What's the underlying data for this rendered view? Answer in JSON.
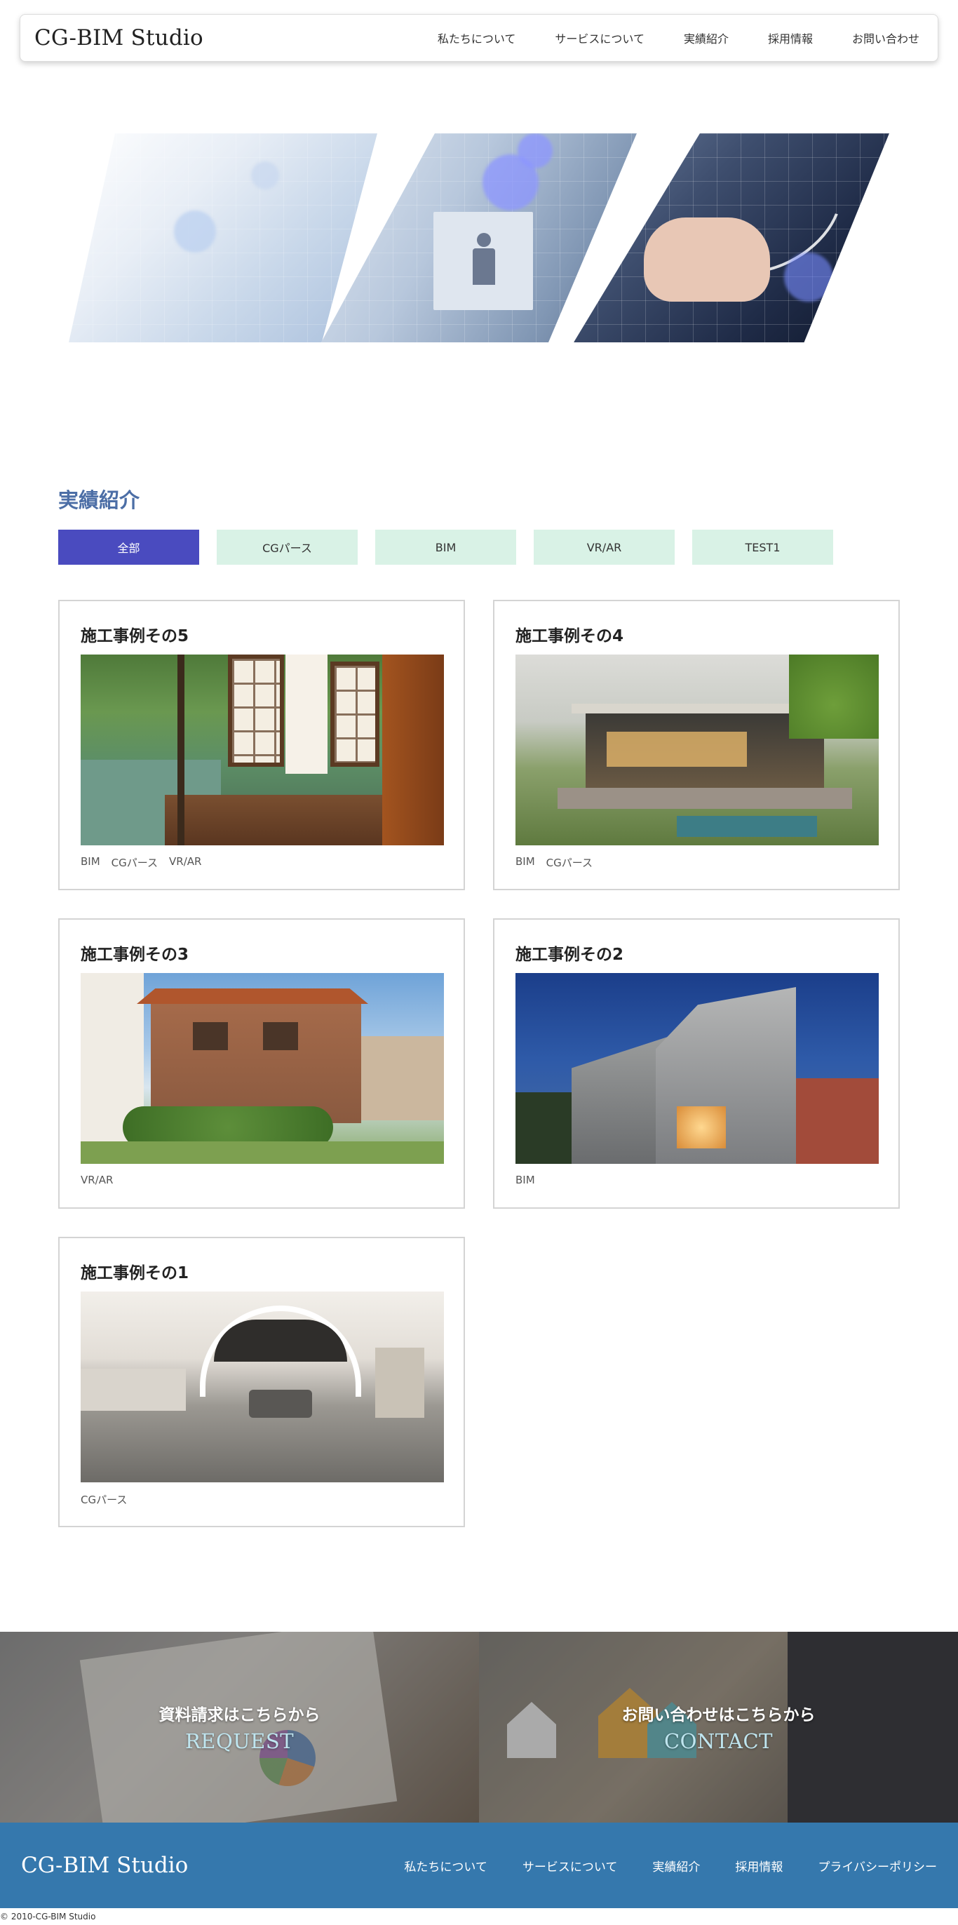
{
  "header": {
    "logo": "CG-BIM Studio",
    "nav": [
      "私たちについて",
      "サービスについて",
      "実績紹介",
      "採用情報",
      "お問い合わせ"
    ]
  },
  "works": {
    "title": "実績紹介",
    "filters": [
      "全部",
      "CGパース",
      "BIM",
      "VR/AR",
      "TEST1"
    ],
    "active_filter": "全部",
    "cards": [
      {
        "title": "施工事例その5",
        "tags": [
          "BIM",
          "CGパース",
          "VR/AR"
        ]
      },
      {
        "title": "施工事例その4",
        "tags": [
          "BIM",
          "CGパース"
        ]
      },
      {
        "title": "施工事例その3",
        "tags": [
          "VR/AR"
        ]
      },
      {
        "title": "施工事例その2",
        "tags": [
          "BIM"
        ]
      },
      {
        "title": "施工事例その1",
        "tags": [
          "CGパース"
        ]
      }
    ]
  },
  "cta": {
    "request": {
      "jp": "資料請求はこちらから",
      "en": "REQUEST"
    },
    "contact": {
      "jp": "お問い合わせはこちらから",
      "en": "CONTACT"
    }
  },
  "footer": {
    "logo": "CG-BIM Studio",
    "nav": [
      "私たちについて",
      "サービスについて",
      "実績紹介",
      "採用情報",
      "プライバシーポリシー"
    ],
    "copyright": "© 2010-CG-BIM Studio"
  },
  "colors": {
    "accent_title": "#4c6ea6",
    "filter_active": "#4a4bbf",
    "filter_inactive": "#d9f2e6",
    "footer_bg": "#3578ad"
  }
}
